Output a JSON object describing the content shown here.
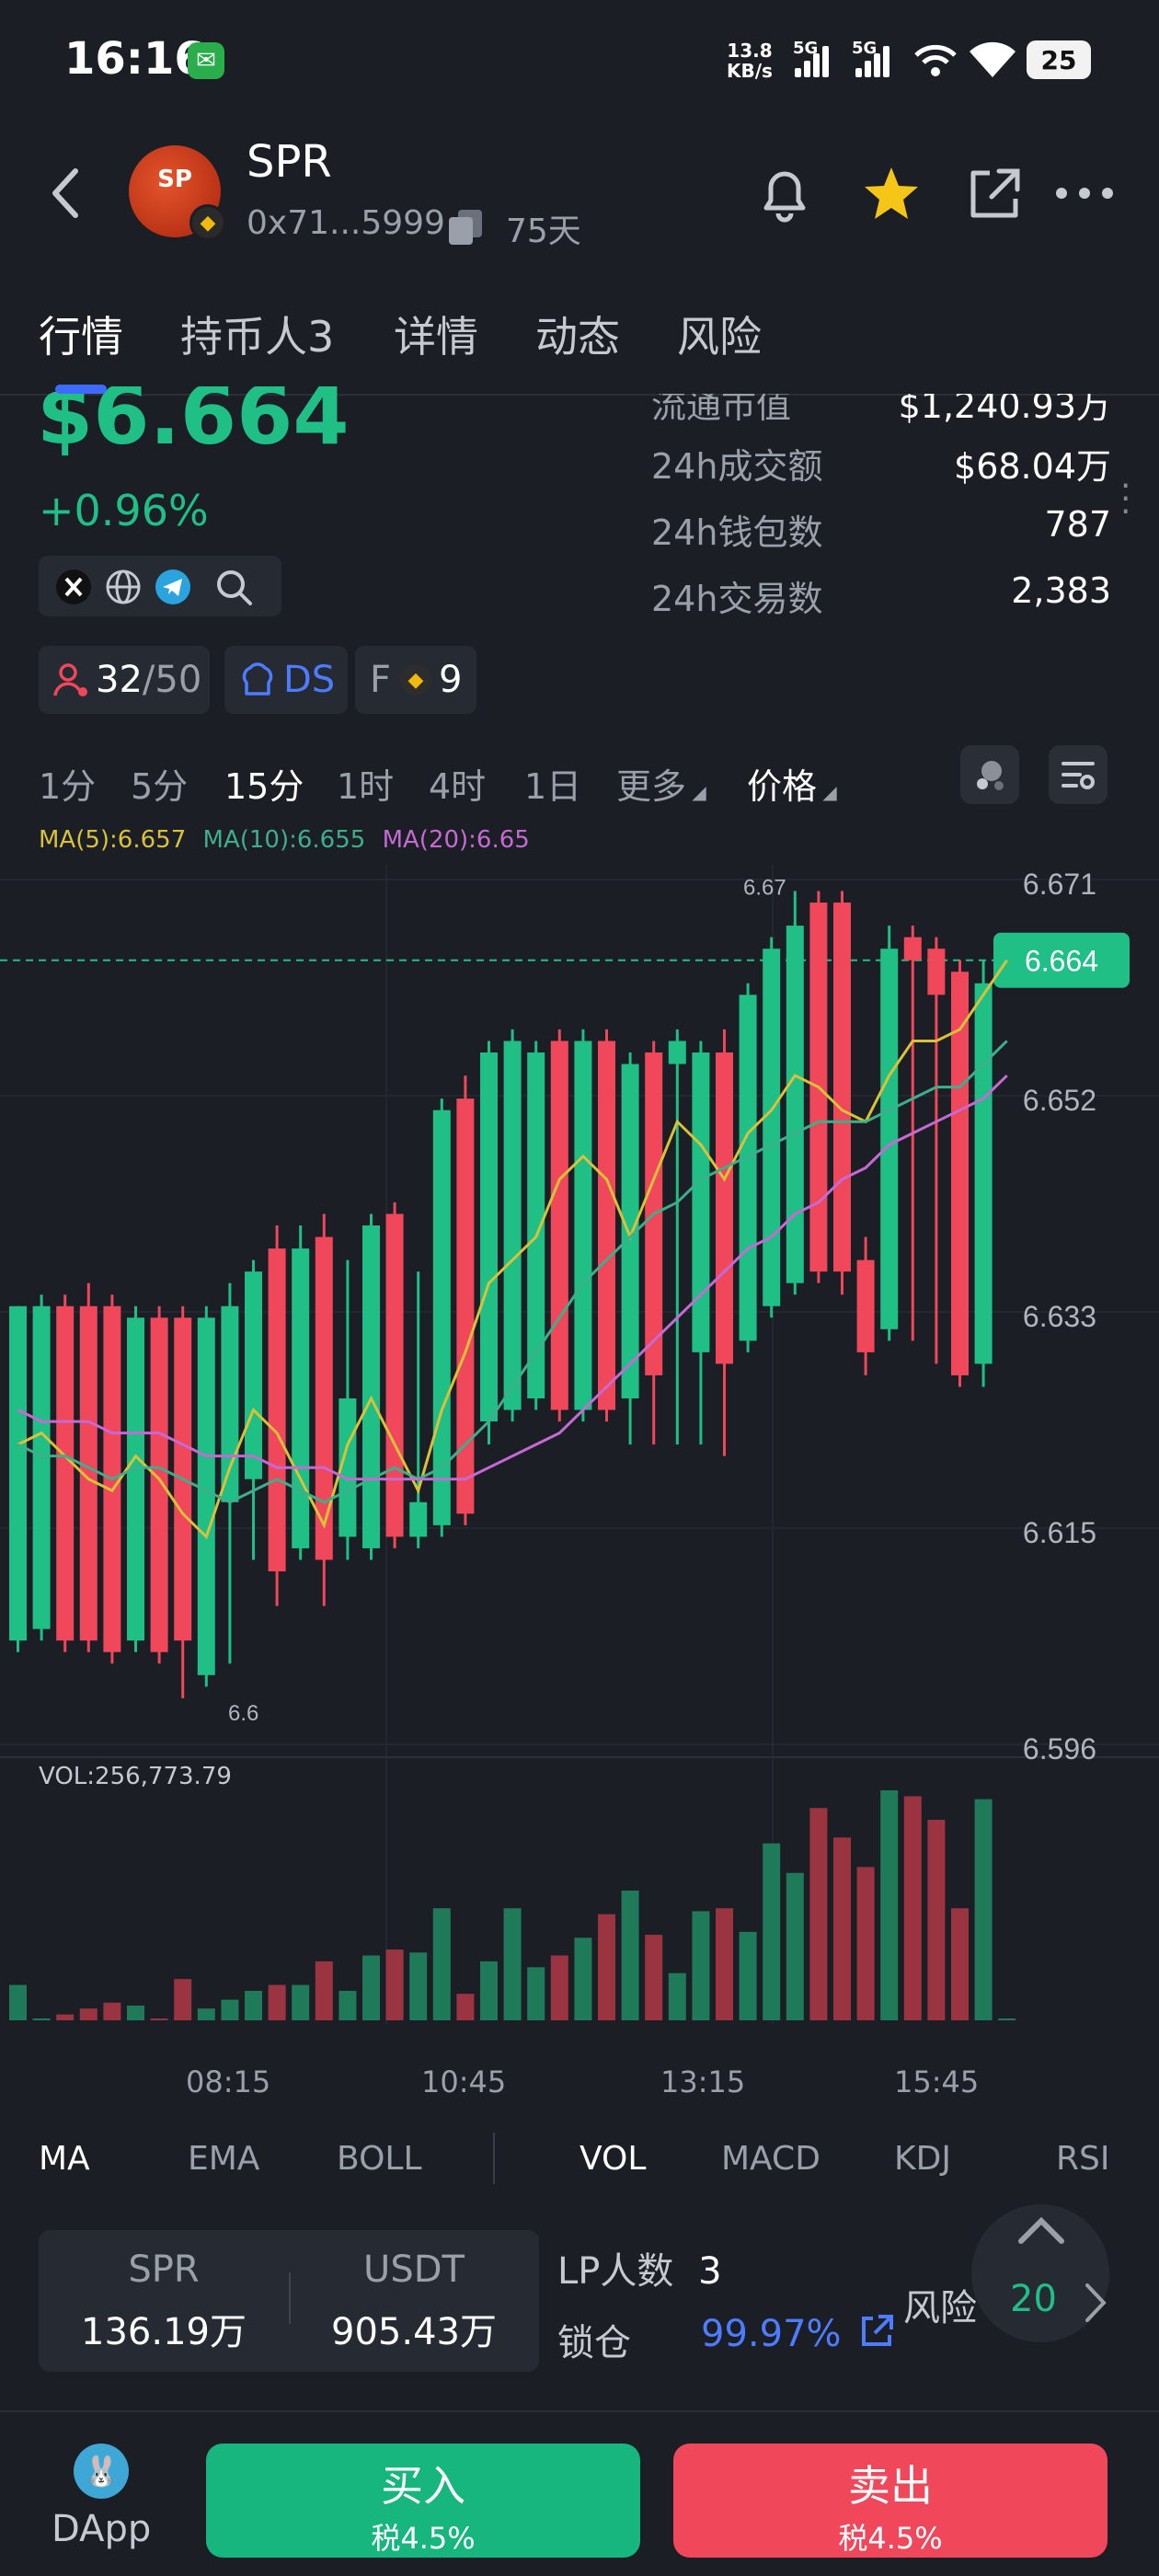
{
  "status_bar": {
    "time": "16:16",
    "net_speed_value": "13.8",
    "net_speed_unit": "KB/s",
    "sim1": "5G",
    "sim2": "5G",
    "battery": "25"
  },
  "token": {
    "name": "SPR",
    "address": "0x71...5999",
    "age": "75天",
    "logo_text": "SP"
  },
  "tabs": [
    {
      "label": "行情"
    },
    {
      "label": "持币人3"
    },
    {
      "label": "详情"
    },
    {
      "label": "动态"
    },
    {
      "label": "风险"
    }
  ],
  "price": {
    "current": "$6.664",
    "change": "+0.96%"
  },
  "tags": {
    "holders": "32",
    "holders_total": "/50",
    "ds": "DS",
    "f_label": "F",
    "f_count": "9"
  },
  "stats": [
    {
      "key": "流通市值",
      "value": "$1,240.93万"
    },
    {
      "key": "24h成交额",
      "value": "$68.04万"
    },
    {
      "key": "24h钱包数",
      "value": "787"
    },
    {
      "key": "24h交易数",
      "value": "2,383"
    }
  ],
  "timeframes": [
    {
      "label": "1分"
    },
    {
      "label": "5分"
    },
    {
      "label": "15分"
    },
    {
      "label": "1时"
    },
    {
      "label": "4时"
    },
    {
      "label": "1日"
    },
    {
      "label": "更多"
    },
    {
      "label": "价格"
    }
  ],
  "ma_legend": {
    "ma5": "MA(5):6.657",
    "ma10": "MA(10):6.655",
    "ma20": "MA(20):6.65"
  },
  "colors": {
    "up": "#1fbf86",
    "down": "#f0475b",
    "ma5": "#d9c13a",
    "ma10": "#3fae8b",
    "ma20": "#c66ad3",
    "link": "#4d7cff"
  },
  "chart_data": {
    "type": "candlestick",
    "price_axis_ticks": [
      "6.671",
      "6.652",
      "6.633",
      "6.615",
      "6.596"
    ],
    "current_price_tag": "6.664",
    "high_label": "6.67",
    "low_label": "6.6",
    "y_range": [
      6.596,
      6.671
    ],
    "time_labels": [
      "08:15",
      "10:45",
      "13:15",
      "15:45"
    ],
    "volume_label": "VOL:256,773.79",
    "candles": [
      {
        "o": 6.605,
        "c": 6.634,
        "h": 6.634,
        "l": 6.604
      },
      {
        "o": 6.606,
        "c": 6.634,
        "h": 6.635,
        "l": 6.605
      },
      {
        "o": 6.634,
        "c": 6.605,
        "h": 6.635,
        "l": 6.604
      },
      {
        "o": 6.634,
        "c": 6.605,
        "h": 6.636,
        "l": 6.604
      },
      {
        "o": 6.634,
        "c": 6.604,
        "h": 6.635,
        "l": 6.603
      },
      {
        "o": 6.605,
        "c": 6.633,
        "h": 6.634,
        "l": 6.604
      },
      {
        "o": 6.633,
        "c": 6.604,
        "h": 6.634,
        "l": 6.603
      },
      {
        "o": 6.633,
        "c": 6.605,
        "h": 6.634,
        "l": 6.6
      },
      {
        "o": 6.602,
        "c": 6.633,
        "h": 6.634,
        "l": 6.601
      },
      {
        "o": 6.617,
        "c": 6.634,
        "h": 6.636,
        "l": 6.603
      },
      {
        "o": 6.619,
        "c": 6.637,
        "h": 6.638,
        "l": 6.612
      },
      {
        "o": 6.639,
        "c": 6.611,
        "h": 6.641,
        "l": 6.608
      },
      {
        "o": 6.613,
        "c": 6.639,
        "h": 6.641,
        "l": 6.612
      },
      {
        "o": 6.64,
        "c": 6.612,
        "h": 6.642,
        "l": 6.608
      },
      {
        "o": 6.614,
        "c": 6.626,
        "h": 6.638,
        "l": 6.612
      },
      {
        "o": 6.613,
        "c": 6.641,
        "h": 6.642,
        "l": 6.612
      },
      {
        "o": 6.642,
        "c": 6.614,
        "h": 6.643,
        "l": 6.613
      },
      {
        "o": 6.614,
        "c": 6.617,
        "h": 6.637,
        "l": 6.613
      },
      {
        "o": 6.615,
        "c": 6.651,
        "h": 6.652,
        "l": 6.614
      },
      {
        "o": 6.652,
        "c": 6.616,
        "h": 6.654,
        "l": 6.615
      },
      {
        "o": 6.624,
        "c": 6.656,
        "h": 6.657,
        "l": 6.622
      },
      {
        "o": 6.625,
        "c": 6.657,
        "h": 6.658,
        "l": 6.624
      },
      {
        "o": 6.626,
        "c": 6.656,
        "h": 6.657,
        "l": 6.625
      },
      {
        "o": 6.657,
        "c": 6.625,
        "h": 6.658,
        "l": 6.624
      },
      {
        "o": 6.625,
        "c": 6.657,
        "h": 6.658,
        "l": 6.624
      },
      {
        "o": 6.657,
        "c": 6.625,
        "h": 6.658,
        "l": 6.624
      },
      {
        "o": 6.626,
        "c": 6.655,
        "h": 6.656,
        "l": 6.622
      },
      {
        "o": 6.656,
        "c": 6.628,
        "h": 6.657,
        "l": 6.622
      },
      {
        "o": 6.655,
        "c": 6.657,
        "h": 6.658,
        "l": 6.622
      },
      {
        "o": 6.63,
        "c": 6.656,
        "h": 6.657,
        "l": 6.622
      },
      {
        "o": 6.656,
        "c": 6.629,
        "h": 6.658,
        "l": 6.621
      },
      {
        "o": 6.631,
        "c": 6.661,
        "h": 6.662,
        "l": 6.63
      },
      {
        "o": 6.634,
        "c": 6.665,
        "h": 6.666,
        "l": 6.633
      },
      {
        "o": 6.636,
        "c": 6.667,
        "h": 6.67,
        "l": 6.635
      },
      {
        "o": 6.669,
        "c": 6.637,
        "h": 6.67,
        "l": 6.636
      },
      {
        "o": 6.669,
        "c": 6.637,
        "h": 6.67,
        "l": 6.635
      },
      {
        "o": 6.638,
        "c": 6.63,
        "h": 6.64,
        "l": 6.628
      },
      {
        "o": 6.632,
        "c": 6.665,
        "h": 6.667,
        "l": 6.631
      },
      {
        "o": 6.666,
        "c": 6.664,
        "h": 6.667,
        "l": 6.631
      },
      {
        "o": 6.665,
        "c": 6.661,
        "h": 6.666,
        "l": 6.629
      },
      {
        "o": 6.663,
        "c": 6.628,
        "h": 6.664,
        "l": 6.627
      },
      {
        "o": 6.629,
        "c": 6.662,
        "h": 6.664,
        "l": 6.627
      },
      {
        "o": 6.664,
        "c": 6.664,
        "h": 6.665,
        "l": 6.663
      }
    ],
    "ma5": [
      6.622,
      6.623,
      6.621,
      6.619,
      6.618,
      6.621,
      6.619,
      6.616,
      6.614,
      6.62,
      6.625,
      6.623,
      6.619,
      6.615,
      6.622,
      6.626,
      6.622,
      6.618,
      6.625,
      6.63,
      6.636,
      6.638,
      6.64,
      6.645,
      6.647,
      6.645,
      6.64,
      6.645,
      6.65,
      6.648,
      6.645,
      6.649,
      6.651,
      6.654,
      6.653,
      6.651,
      6.65,
      6.654,
      6.657,
      6.657,
      6.658,
      6.661,
      6.664
    ],
    "ma10": [
      6.622,
      6.621,
      6.621,
      6.62,
      6.619,
      6.62,
      6.62,
      6.619,
      6.618,
      6.617,
      6.618,
      6.619,
      6.618,
      6.617,
      6.618,
      6.619,
      6.62,
      6.619,
      6.62,
      6.622,
      6.624,
      6.627,
      6.63,
      6.633,
      6.636,
      6.638,
      6.64,
      6.642,
      6.643,
      6.645,
      6.646,
      6.647,
      6.648,
      6.649,
      6.65,
      6.65,
      6.65,
      6.651,
      6.652,
      6.653,
      6.653,
      6.655,
      6.657
    ],
    "ma20": [
      6.625,
      6.624,
      6.624,
      6.624,
      6.623,
      6.623,
      6.623,
      6.622,
      6.621,
      6.621,
      6.621,
      6.62,
      6.62,
      6.62,
      6.619,
      6.619,
      6.619,
      6.619,
      6.619,
      6.619,
      6.62,
      6.621,
      6.622,
      6.623,
      6.625,
      6.627,
      6.629,
      6.631,
      6.633,
      6.635,
      6.637,
      6.639,
      6.64,
      6.642,
      6.643,
      6.645,
      6.646,
      6.648,
      6.649,
      6.65,
      6.651,
      6.652,
      6.654
    ],
    "volumes": [
      12,
      0,
      2,
      4,
      6,
      5,
      0,
      14,
      4,
      7,
      10,
      12,
      12,
      20,
      10,
      22,
      24,
      23,
      38,
      9,
      20,
      38,
      18,
      22,
      28,
      36,
      44,
      29,
      16,
      37,
      38,
      30,
      60,
      50,
      72,
      62,
      52,
      78,
      76,
      68,
      38,
      75,
      0
    ]
  },
  "indicators": [
    {
      "label": "MA"
    },
    {
      "label": "EMA"
    },
    {
      "label": "BOLL"
    },
    {
      "label": "VOL"
    },
    {
      "label": "MACD"
    },
    {
      "label": "KDJ"
    },
    {
      "label": "RSI"
    }
  ],
  "liquidity": {
    "sym1": "SPR",
    "amt1": "136.19万",
    "sym2": "USDT",
    "amt2": "905.43万",
    "lp_label": "LP人数",
    "lp_count": "3",
    "lock_label": "锁仓",
    "lock_value": "99.97%",
    "risk_label": "风险",
    "risk_value": "20"
  },
  "bottom": {
    "dapp_label": "DApp",
    "buy_label": "买入",
    "buy_tax": "税4.5%",
    "sell_label": "卖出",
    "sell_tax": "税4.5%"
  }
}
